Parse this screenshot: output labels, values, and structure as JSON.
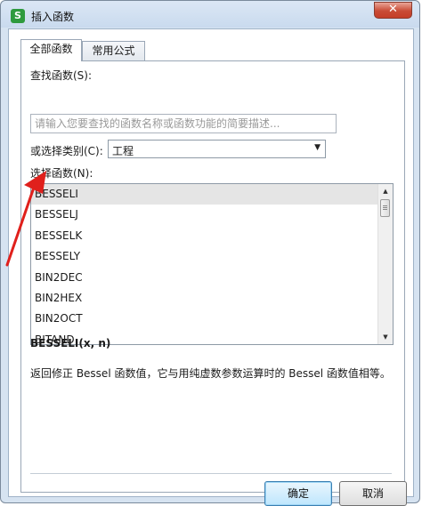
{
  "window": {
    "title": "插入函数",
    "app_icon_letter": "S",
    "close_glyph": "✕"
  },
  "tabs": [
    {
      "label": "全部函数",
      "active": true
    },
    {
      "label": "常用公式",
      "active": false
    }
  ],
  "search": {
    "label": "查找函数(S):",
    "placeholder": "请输入您要查找的函数名称或函数功能的简要描述..."
  },
  "category": {
    "label": "或选择类别(C):",
    "value": "工程"
  },
  "function_list": {
    "label": "选择函数(N):",
    "items": [
      "BESSELI",
      "BESSELJ",
      "BESSELK",
      "BESSELY",
      "BIN2DEC",
      "BIN2HEX",
      "BIN2OCT",
      "BITAND"
    ],
    "selected_index": 0
  },
  "detail": {
    "signature": "BESSELI(x, n)",
    "description": "返回修正 Bessel 函数值，它与用纯虚数参数运算时的 Bessel 函数值相等。"
  },
  "buttons": {
    "ok": "确定",
    "cancel": "取消"
  },
  "annotation": {
    "color": "#e0201c",
    "icon": "red-pointer-arrow"
  },
  "colors": {
    "titlebar": "#c9daee",
    "close_button": "#c94b35",
    "selected_row": "#e5e5e5"
  }
}
